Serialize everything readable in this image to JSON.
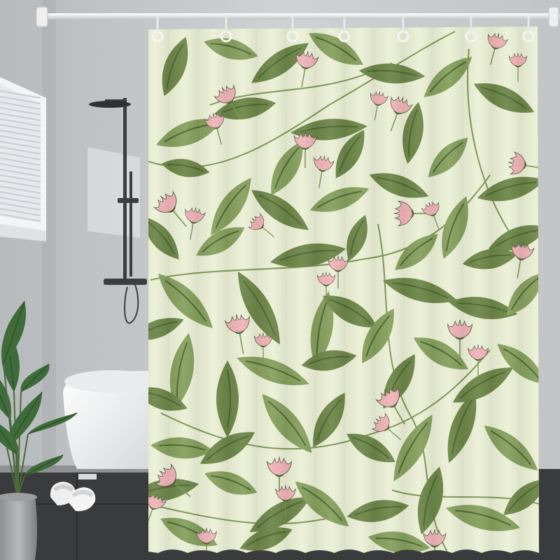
{
  "scene": {
    "subject": "shower-curtain-product-photo",
    "colors": {
      "wall": "#c4c6c8",
      "floor": "#3a3b3d",
      "curtain_bg": "#ebf0d6",
      "leaf_dark": "#6d8648",
      "leaf_light": "#86a05e",
      "leaf_vein": "#4e6633",
      "flower": "#f0b4b8",
      "stem": "#7d9656",
      "rod": "#e8e8e8"
    },
    "items": [
      "curtain-rod",
      "curtain-rings",
      "shower-curtain",
      "rain-shower-head",
      "bathroom-window",
      "bathtub",
      "potted-plant",
      "slippers"
    ]
  }
}
